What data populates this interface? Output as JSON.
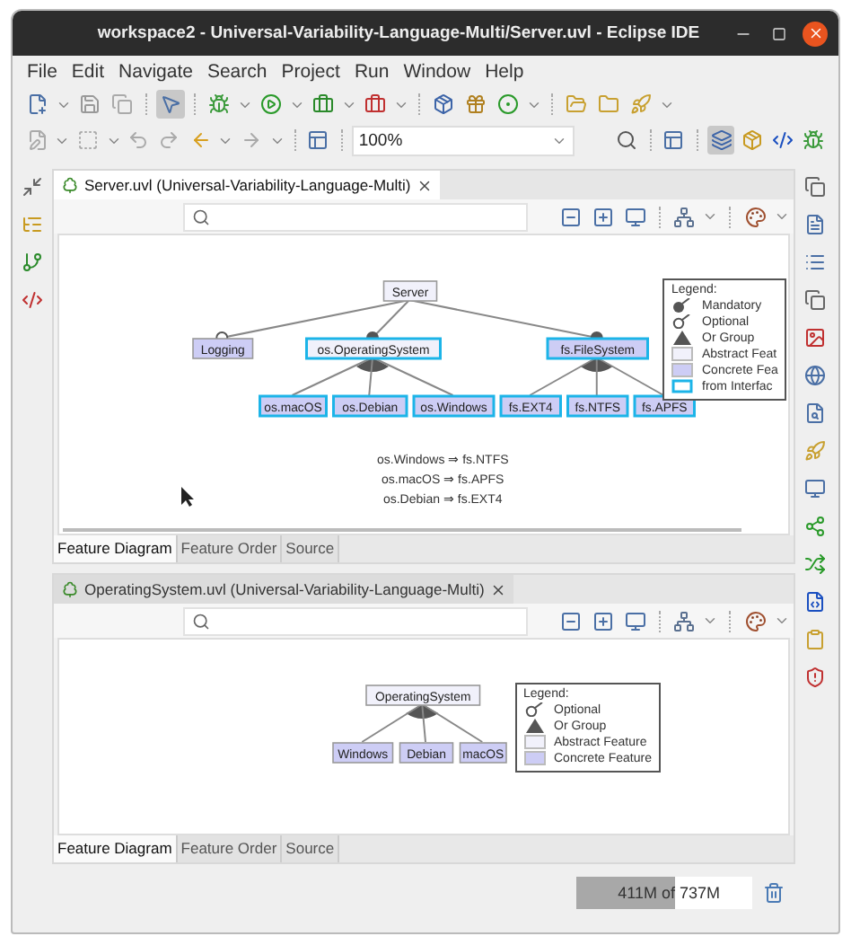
{
  "window": {
    "title": "workspace2 - Universal-Variability-Language-Multi/Server.uvl - Eclipse IDE"
  },
  "menu": [
    "File",
    "Edit",
    "Navigate",
    "Search",
    "Project",
    "Run",
    "Window",
    "Help"
  ],
  "toolbar": {
    "toggle": {
      "selected": true
    },
    "zoom": "100%"
  },
  "perspectives": [
    {
      "selected": true
    },
    {
      "selected": false
    },
    {
      "selected": false
    },
    {
      "selected": false
    }
  ],
  "editors": [
    {
      "title": "Server.uvl (Universal-Variability-Language-Multi)",
      "selected": true,
      "diagram": {
        "root": {
          "name": "Server",
          "kind": "abstract",
          "children": [
            {
              "name": "Logging",
              "kind": "concrete",
              "mandatory": false
            },
            {
              "name": "os.OperatingSystem",
              "kind": "abstract",
              "interface": true,
              "mandatory": true,
              "or_group": true,
              "children": [
                {
                  "name": "os.macOS",
                  "kind": "concrete",
                  "interface": true
                },
                {
                  "name": "os.Debian",
                  "kind": "concrete",
                  "interface": true
                },
                {
                  "name": "os.Windows",
                  "kind": "concrete",
                  "interface": true
                }
              ]
            },
            {
              "name": "fs.FileSystem",
              "kind": "concrete",
              "interface": true,
              "mandatory": true,
              "or_group": true,
              "children": [
                {
                  "name": "fs.EXT4",
                  "kind": "concrete",
                  "interface": true
                },
                {
                  "name": "fs.NTFS",
                  "kind": "concrete",
                  "interface": true
                },
                {
                  "name": "fs.APFS",
                  "kind": "concrete",
                  "interface": true
                }
              ]
            }
          ]
        },
        "constraints": [
          "os.Windows ⇒ fs.NTFS",
          "os.macOS ⇒ fs.APFS",
          "os.Debian ⇒ fs.EXT4"
        ],
        "legend": {
          "title": "Legend:",
          "items": [
            {
              "kind": "mandatory",
              "label": "Mandatory"
            },
            {
              "kind": "optional",
              "label": "Optional"
            },
            {
              "kind": "or",
              "label": "Or Group"
            },
            {
              "kind": "abstract",
              "label": "Abstract Feat"
            },
            {
              "kind": "concrete",
              "label": "Concrete Fea"
            },
            {
              "kind": "interface",
              "label": "from Interfac"
            }
          ]
        }
      },
      "bottom_tabs": [
        {
          "label": "Feature Diagram",
          "selected": true
        },
        {
          "label": "Feature Order",
          "selected": false
        },
        {
          "label": "Source",
          "selected": false
        }
      ]
    },
    {
      "title": "OperatingSystem.uvl (Universal-Variability-Language-Multi)",
      "selected": false,
      "diagram": {
        "root": {
          "name": "OperatingSystem",
          "kind": "abstract",
          "or_group": true,
          "children": [
            {
              "name": "Windows",
              "kind": "concrete"
            },
            {
              "name": "Debian",
              "kind": "concrete"
            },
            {
              "name": "macOS",
              "kind": "concrete"
            }
          ]
        },
        "legend": {
          "title": "Legend:",
          "items": [
            {
              "kind": "optional",
              "label": "Optional"
            },
            {
              "kind": "or",
              "label": "Or Group"
            },
            {
              "kind": "abstract",
              "label": "Abstract Feature"
            },
            {
              "kind": "concrete",
              "label": "Concrete Feature"
            }
          ]
        }
      },
      "bottom_tabs": [
        {
          "label": "Feature Diagram",
          "selected": true
        },
        {
          "label": "Feature Order",
          "selected": false
        },
        {
          "label": "Source",
          "selected": false
        }
      ]
    }
  ],
  "memory": {
    "text": "411M of 737M",
    "level": 0.558
  }
}
